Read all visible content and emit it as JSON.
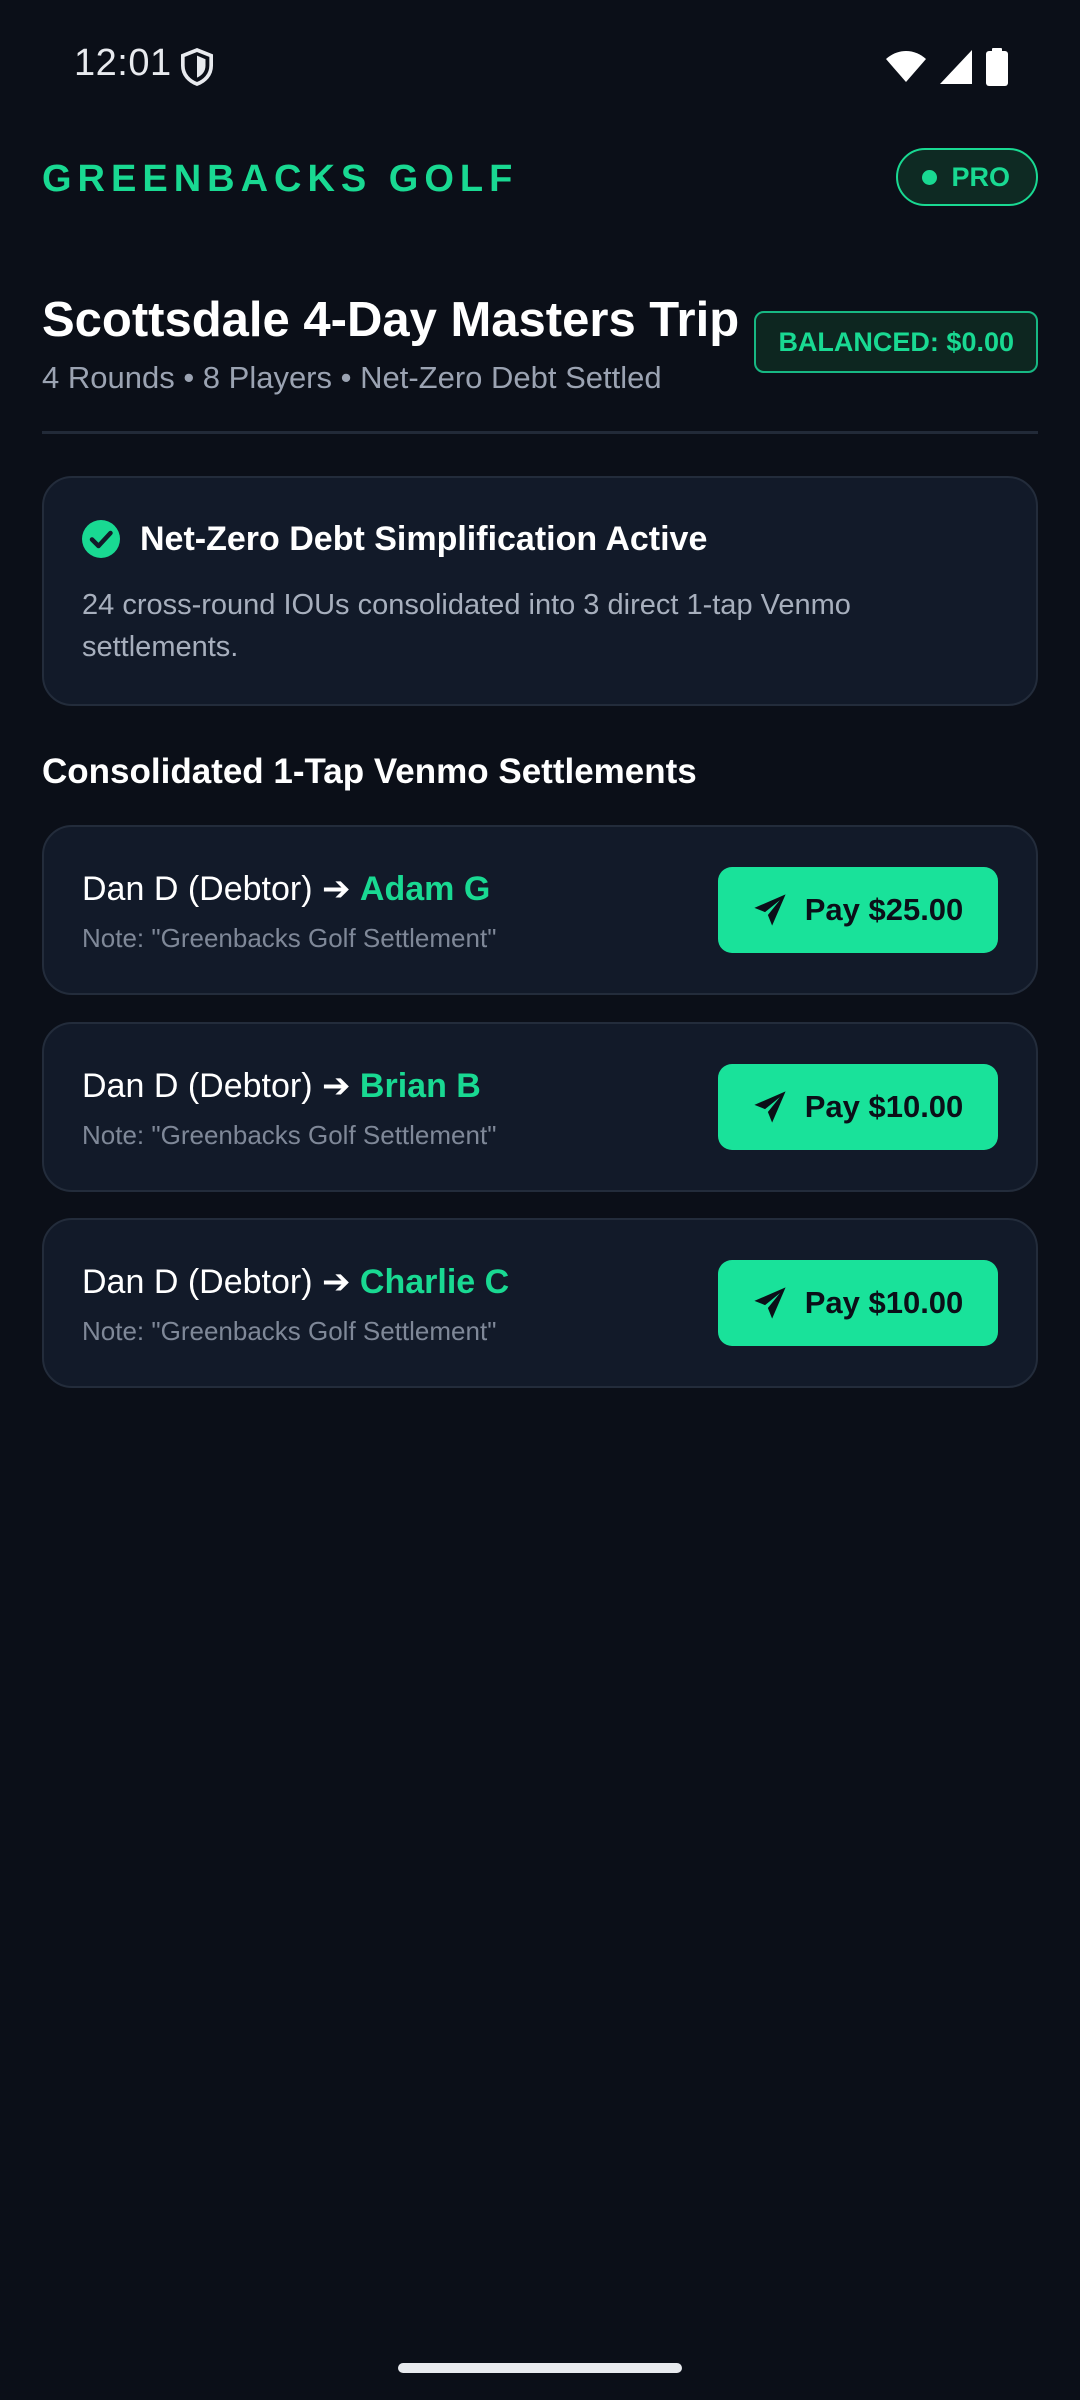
{
  "status_bar": {
    "time": "12:01"
  },
  "header": {
    "brand": "GREENBACKS GOLF",
    "badge": "PRO"
  },
  "trip": {
    "title": "Scottsdale 4-Day Masters Trip",
    "subtitle": "4 Rounds • 8 Players • Net-Zero Debt Settled",
    "balance_badge": "BALANCED: $0.00"
  },
  "info_card": {
    "title": "Net-Zero Debt Simplification Active",
    "body": "24 cross-round IOUs consolidated into 3 direct 1-tap Venmo settlements."
  },
  "settlements": {
    "section_title": "Consolidated 1-Tap Venmo Settlements",
    "arrow": "➔",
    "items": [
      {
        "debtor": "Dan D (Debtor)",
        "recipient": "Adam G",
        "note": "Note: \"Greenbacks Golf Settlement\"",
        "button": "Pay $25.00"
      },
      {
        "debtor": "Dan D (Debtor)",
        "recipient": "Brian B",
        "note": "Note: \"Greenbacks Golf Settlement\"",
        "button": "Pay $10.00"
      },
      {
        "debtor": "Dan D (Debtor)",
        "recipient": "Charlie C",
        "note": "Note: \"Greenbacks Golf Settlement\"",
        "button": "Pay $10.00"
      }
    ]
  },
  "colors": {
    "background": "#0b0f18",
    "card": "#121a29",
    "accent": "#19e29a",
    "muted_text": "#9ba3b2"
  },
  "icons": {
    "status_shield": "shield-icon",
    "wifi": "wifi-icon",
    "signal": "cell-signal-icon",
    "battery": "battery-icon",
    "check": "check-circle-icon",
    "send": "paper-plane-icon"
  }
}
